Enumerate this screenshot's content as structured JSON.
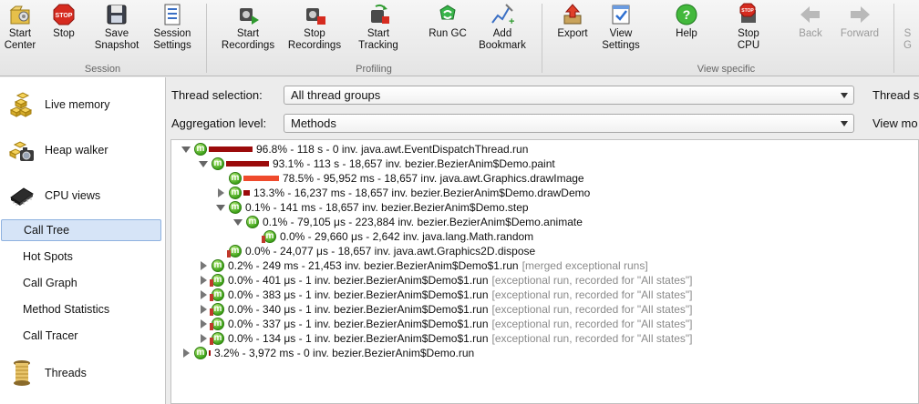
{
  "toolbar": {
    "groups": {
      "session": "Session",
      "profiling": "Profiling",
      "view_specific": "View specific"
    },
    "buttons": {
      "start_center": [
        "Start",
        "Center"
      ],
      "stop": [
        "Stop"
      ],
      "save_snapshot": [
        "Save",
        "Snapshot"
      ],
      "session_settings": [
        "Session",
        "Settings"
      ],
      "start_recordings": [
        "Start",
        "Recordings"
      ],
      "stop_recordings": [
        "Stop",
        "Recordings"
      ],
      "start_tracking": [
        "Start",
        "Tracking"
      ],
      "run_gc": [
        "Run GC"
      ],
      "add_bookmark": [
        "Add",
        "Bookmark"
      ],
      "export": [
        "Export"
      ],
      "view_settings": [
        "View",
        "Settings"
      ],
      "help": [
        "Help"
      ],
      "stop_cpu": [
        "Stop",
        "CPU"
      ],
      "back": [
        "Back"
      ],
      "forward": [
        "Forward"
      ],
      "partial": [
        "S",
        "G"
      ]
    }
  },
  "sidebar": {
    "sections": {
      "live_memory": "Live memory",
      "heap_walker": "Heap walker",
      "cpu_views": "CPU views",
      "threads": "Threads"
    },
    "items": {
      "call_tree": "Call Tree",
      "hot_spots": "Hot Spots",
      "call_graph": "Call Graph",
      "method_statistics": "Method Statistics",
      "call_tracer": "Call Tracer"
    },
    "selected": "Call Tree"
  },
  "main": {
    "thread_selection_label": "Thread selection:",
    "thread_selection_value": "All thread groups",
    "aggregation_label": "Aggregation level:",
    "aggregation_value": "Methods",
    "right_label_1": "Thread s",
    "right_label_2": "View mo"
  },
  "tree": {
    "bar_color_dark": "#9b0b0b",
    "bar_color_light": "#ef4a2c",
    "rows": [
      {
        "text": "96.8% - 118 s - 0 inv. java.awt.EventDispatchThread.run",
        "percent": 96.8,
        "toggle": "open",
        "depth": 0
      },
      {
        "text": "93.1% - 113 s - 18,657 inv. bezier.BezierAnim$Demo.paint",
        "percent": 93.1,
        "toggle": "open",
        "depth": 1
      },
      {
        "text": "78.5% - 95,952 ms - 18,657 inv. java.awt.Graphics.drawImage",
        "percent": 78.5,
        "toggle": "none",
        "depth": 2,
        "light": true
      },
      {
        "text": "13.3% - 16,237 ms - 18,657 inv. bezier.BezierAnim$Demo.drawDemo",
        "percent": 13.3,
        "toggle": "closed",
        "depth": 2
      },
      {
        "text": "0.1% - 141 ms - 18,657 inv. bezier.BezierAnim$Demo.step",
        "percent": 0.1,
        "toggle": "open",
        "depth": 2
      },
      {
        "text": "0.1% - 79,105 μs - 223,884 inv. bezier.BezierAnim$Demo.animate",
        "percent": 0.1,
        "toggle": "open",
        "depth": 3
      },
      {
        "text": "0.0% - 29,660 μs - 2,642 inv. java.lang.Math.random",
        "percent": 0.0,
        "toggle": "none",
        "depth": 4,
        "exc": true
      },
      {
        "text": "0.0% - 24,077 μs - 18,657 inv. java.awt.Graphics2D.dispose",
        "percent": 0.0,
        "toggle": "none",
        "depth": 2,
        "exc": true
      },
      {
        "text": "0.2% - 249 ms - 21,453 inv. bezier.BezierAnim$Demo$1.run",
        "note": "[merged exceptional runs]",
        "percent": 0.2,
        "toggle": "closed",
        "depth": 1
      },
      {
        "text": "0.0% - 401 μs - 1 inv. bezier.BezierAnim$Demo$1.run",
        "note": "[exceptional run, recorded for \"All states\"]",
        "percent": 0.0,
        "toggle": "closed",
        "depth": 1,
        "exc": true
      },
      {
        "text": "0.0% - 383 μs - 1 inv. bezier.BezierAnim$Demo$1.run",
        "note": "[exceptional run, recorded for \"All states\"]",
        "percent": 0.0,
        "toggle": "closed",
        "depth": 1,
        "exc": true
      },
      {
        "text": "0.0% - 340 μs - 1 inv. bezier.BezierAnim$Demo$1.run",
        "note": "[exceptional run, recorded for \"All states\"]",
        "percent": 0.0,
        "toggle": "closed",
        "depth": 1,
        "exc": true
      },
      {
        "text": "0.0% - 337 μs - 1 inv. bezier.BezierAnim$Demo$1.run",
        "note": "[exceptional run, recorded for \"All states\"]",
        "percent": 0.0,
        "toggle": "closed",
        "depth": 1,
        "exc": true
      },
      {
        "text": "0.0% - 134 μs - 1 inv. bezier.BezierAnim$Demo$1.run",
        "note": "[exceptional run, recorded for \"All states\"]",
        "percent": 0.0,
        "toggle": "closed",
        "depth": 1,
        "exc": true
      },
      {
        "text": "3.2% - 3,972 ms - 0 inv. bezier.BezierAnim$Demo.run",
        "percent": 3.2,
        "toggle": "closed",
        "depth": 0
      }
    ]
  }
}
